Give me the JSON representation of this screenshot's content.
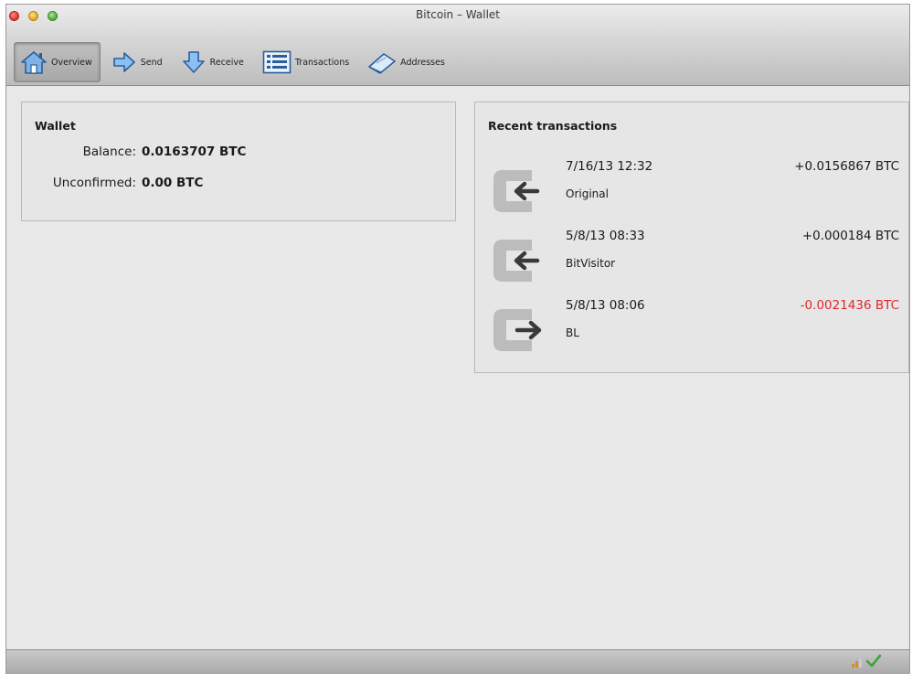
{
  "window": {
    "title": "Bitcoin – Wallet"
  },
  "toolbar": {
    "items": [
      {
        "label": "Overview",
        "icon": "home-icon",
        "active": true
      },
      {
        "label": "Send",
        "icon": "send-arrow-icon"
      },
      {
        "label": "Receive",
        "icon": "receive-arrow-icon"
      },
      {
        "label": "Transactions",
        "icon": "list-icon"
      },
      {
        "label": "Addresses",
        "icon": "address-book-icon"
      }
    ]
  },
  "wallet": {
    "title": "Wallet",
    "balance_label": "Balance:",
    "balance_value": "0.0163707 BTC",
    "unconfirmed_label": "Unconfirmed:",
    "unconfirmed_value": "0.00 BTC"
  },
  "recent": {
    "title": "Recent transactions",
    "transactions": [
      {
        "date": "7/16/13 12:32",
        "label": "Original",
        "amount": "+0.0156867 BTC",
        "direction": "incoming"
      },
      {
        "date": "5/8/13 08:33",
        "label": "BitVisitor",
        "amount": "+0.000184 BTC",
        "direction": "incoming"
      },
      {
        "date": "5/8/13 08:06",
        "label": "BL",
        "amount": "-0.0021436 BTC",
        "direction": "outgoing"
      }
    ]
  },
  "colors": {
    "negative_amount": "#e0282c"
  },
  "statusbar": {
    "icons": [
      "connection-bars-icon",
      "synced-checkmark-icon"
    ]
  }
}
